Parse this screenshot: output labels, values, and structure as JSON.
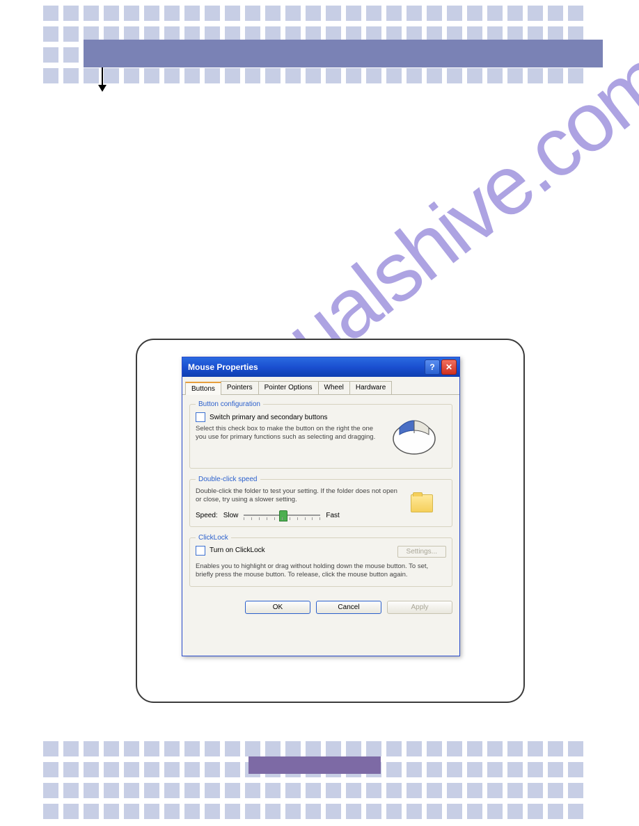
{
  "watermark": "manualshive.com",
  "dialog": {
    "title": "Mouse Properties",
    "tabs": [
      "Buttons",
      "Pointers",
      "Pointer Options",
      "Wheel",
      "Hardware"
    ],
    "active_tab": 0,
    "button_config": {
      "legend": "Button configuration",
      "checkbox_label": "Switch primary and secondary buttons",
      "description": "Select this check box to make the button on the right the one you use for primary functions such as selecting and dragging."
    },
    "double_click": {
      "legend": "Double-click speed",
      "description": "Double-click the folder to test your setting. If the folder does not open or close, try using a slower setting.",
      "speed_label": "Speed:",
      "slow_label": "Slow",
      "fast_label": "Fast"
    },
    "clicklock": {
      "legend": "ClickLock",
      "checkbox_label": "Turn on ClickLock",
      "settings_button": "Settings...",
      "description": "Enables you to highlight or drag without holding down the mouse button. To set, briefly press the mouse button. To release, click the mouse button again."
    },
    "footer": {
      "ok": "OK",
      "cancel": "Cancel",
      "apply": "Apply"
    }
  }
}
